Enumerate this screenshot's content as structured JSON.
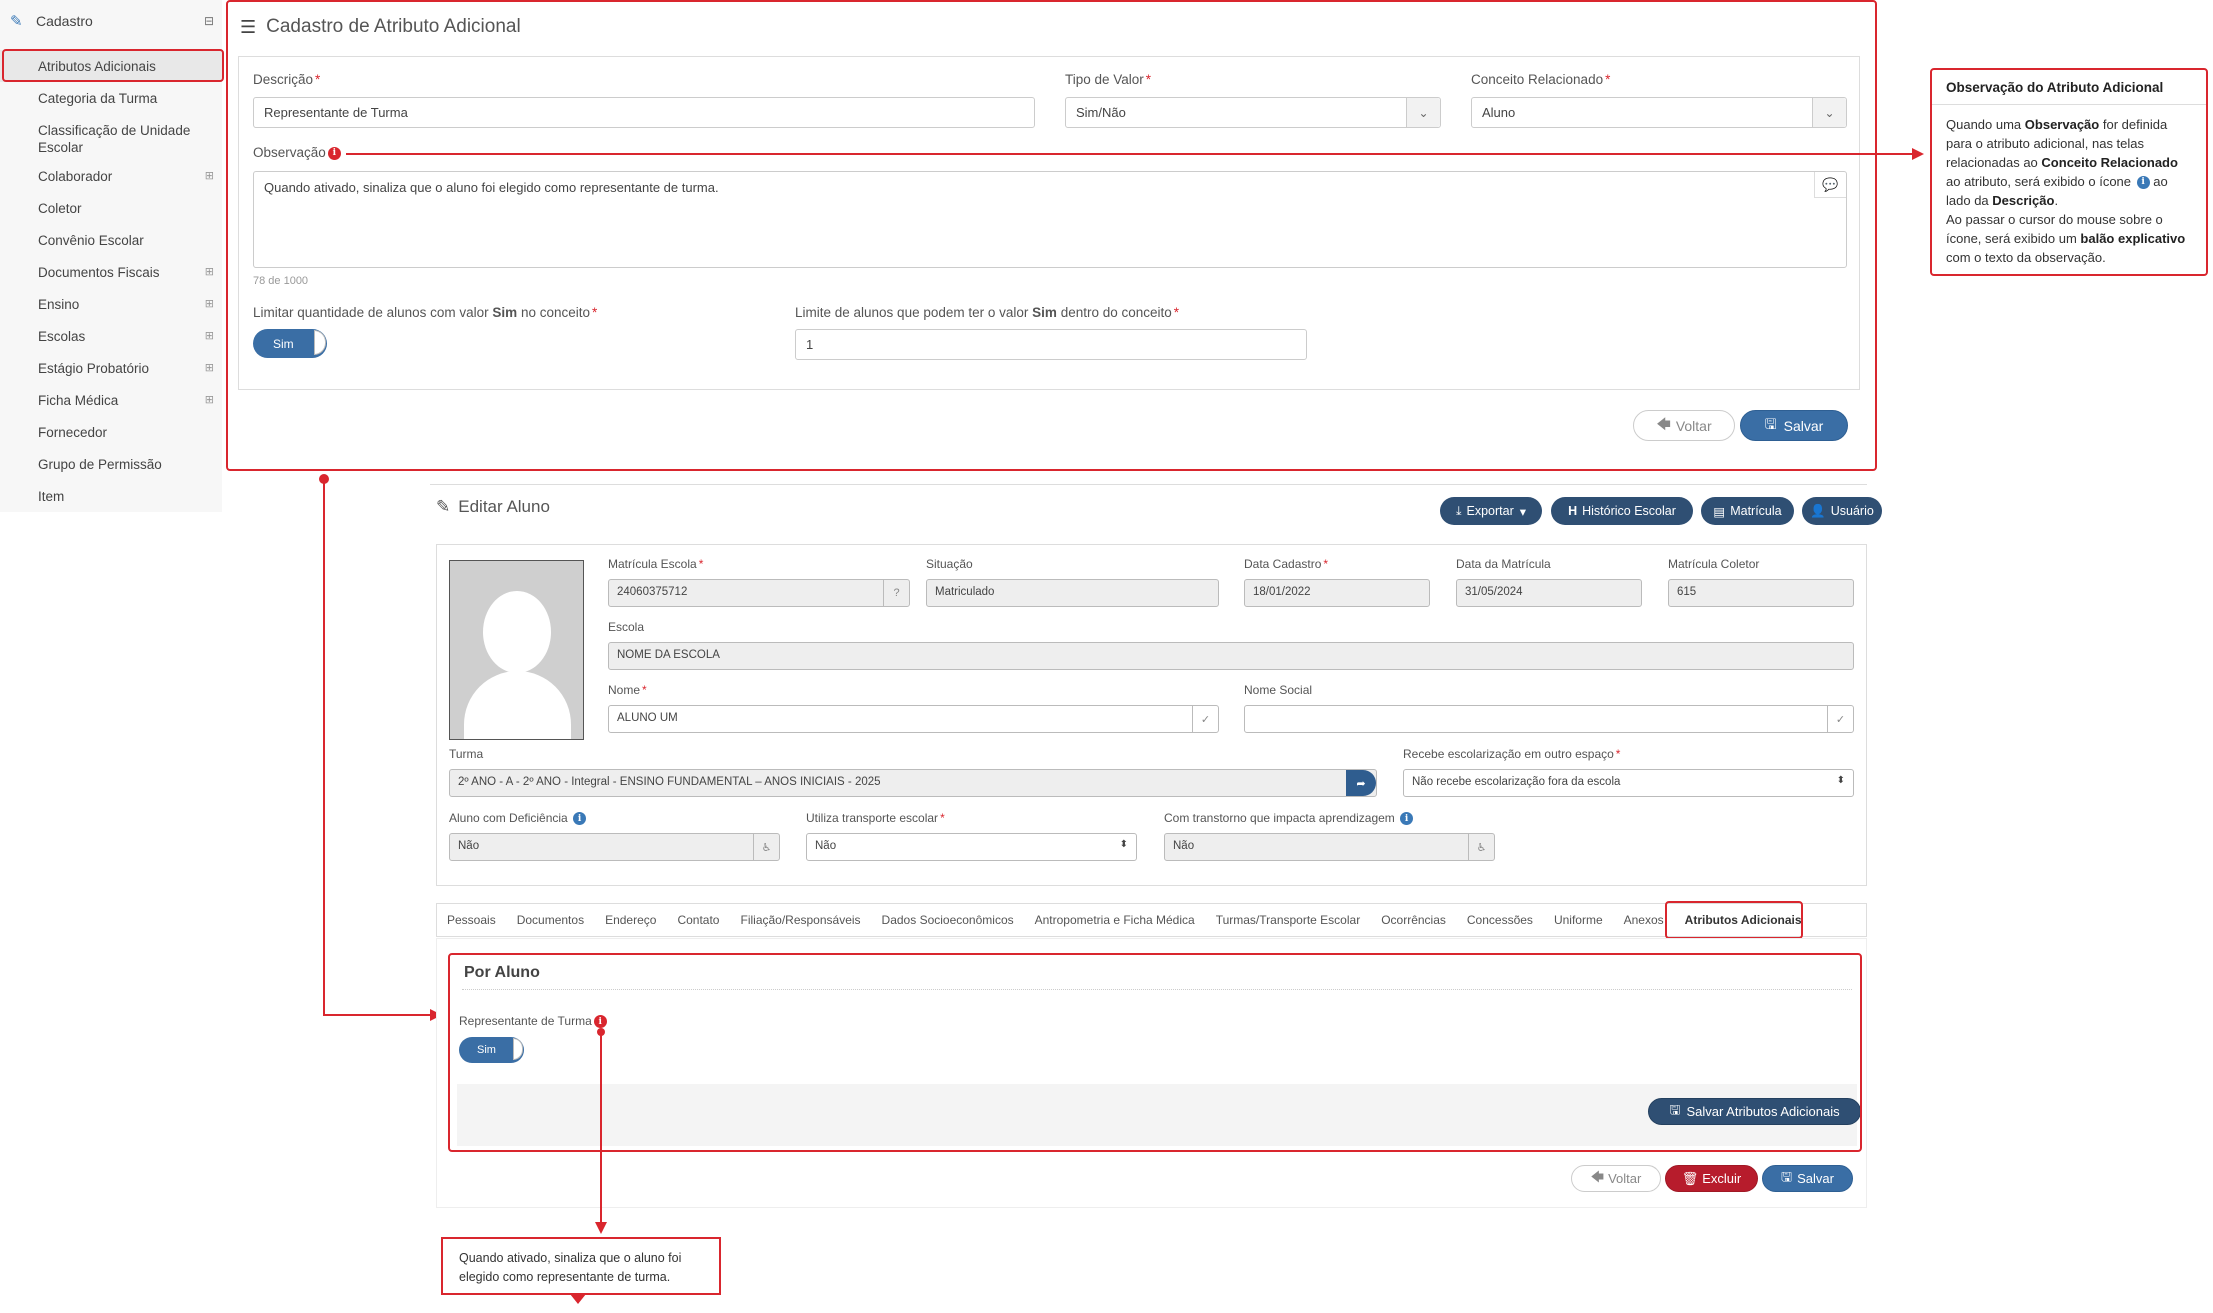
{
  "sidebar": {
    "header": "Cadastro",
    "items": [
      {
        "label": "Atributos Adicionais",
        "expandable": false
      },
      {
        "label": "Categoria da Turma",
        "expandable": false
      },
      {
        "label": "Classificação de Unidade Escolar",
        "expandable": false
      },
      {
        "label": "Colaborador",
        "expandable": true
      },
      {
        "label": "Coletor",
        "expandable": false
      },
      {
        "label": "Convênio Escolar",
        "expandable": false
      },
      {
        "label": "Documentos Fiscais",
        "expandable": true
      },
      {
        "label": "Ensino",
        "expandable": true
      },
      {
        "label": "Escolas",
        "expandable": true
      },
      {
        "label": "Estágio Probatório",
        "expandable": true
      },
      {
        "label": "Ficha Médica",
        "expandable": true
      },
      {
        "label": "Fornecedor",
        "expandable": false
      },
      {
        "label": "Grupo de Permissão",
        "expandable": false
      },
      {
        "label": "Item",
        "expandable": false
      }
    ]
  },
  "form": {
    "title": "Cadastro de Atributo Adicional",
    "descricao_label": "Descrição",
    "descricao_value": "Representante de Turma",
    "tipo_label": "Tipo de Valor",
    "tipo_value": "Sim/Não",
    "conceito_label": "Conceito Relacionado",
    "conceito_value": "Aluno",
    "observacao_label": "Observação",
    "observacao_value": "Quando ativado, sinaliza que o aluno foi elegido como representante de turma.",
    "char_count": "78 de 1000",
    "limitar_label_pre": "Limitar quantidade de alunos com valor",
    "limitar_label_bold": "Sim",
    "limitar_label_post": "no conceito",
    "limitar_toggle": "Sim",
    "limite_label_pre": "Limite de alunos que podem ter o valor",
    "limite_label_bold": "Sim",
    "limite_label_post": "dentro do conceito",
    "limite_value": "1",
    "btn_voltar": "Voltar",
    "btn_salvar": "Salvar"
  },
  "note": {
    "title": "Observação do Atributo Adicional",
    "p1": "Quando uma",
    "p1b": "Observação",
    "p2": "for definida para o atributo adicional, nas telas relacionadas ao",
    "p2b": "Conceito Relacionado",
    "p3": "ao atributo, será exibido o ícone",
    "p4": "ao lado da",
    "p4b": "Descrição",
    "p4c": ".",
    "p5": "Ao passar o cursor do mouse sobre o ícone, será exibido um",
    "p5b": "balão explicativo",
    "p6": "com o texto da observação."
  },
  "aluno": {
    "title": "Editar Aluno",
    "btn_exportar": "Exportar",
    "btn_historico": "Histórico Escolar",
    "btn_matricula": "Matrícula",
    "btn_usuario": "Usuário",
    "matricula_escola_label": "Matrícula Escola",
    "matricula_escola_value": "24060375712",
    "situacao_label": "Situação",
    "situacao_value": "Matriculado",
    "data_cadastro_label": "Data Cadastro",
    "data_cadastro_value": "18/01/2022",
    "data_matricula_label": "Data da Matrícula",
    "data_matricula_value": "31/05/2024",
    "matricula_coletor_label": "Matrícula Coletor",
    "matricula_coletor_value": "615",
    "escola_label": "Escola",
    "escola_value": "NOME DA ESCOLA",
    "nome_label": "Nome",
    "nome_value": "ALUNO UM",
    "nome_social_label": "Nome Social",
    "nome_social_value": "",
    "turma_label": "Turma",
    "turma_value": "2º ANO - A - 2º ANO - Integral - ENSINO FUNDAMENTAL – ANOS INICIAIS - 2025",
    "recebe_label": "Recebe escolarização em outro espaço",
    "recebe_value": "Não recebe escolarização fora da escola",
    "deficiencia_label": "Aluno com Deficiência",
    "deficiencia_value": "Não",
    "transporte_label": "Utiliza transporte escolar",
    "transporte_value": "Não",
    "transtorno_label": "Com transtorno que impacta aprendizagem",
    "transtorno_value": "Não",
    "tabs": [
      "Pessoais",
      "Documentos",
      "Endereço",
      "Contato",
      "Filiação/Responsáveis",
      "Dados Socioeconômicos",
      "Antropometria e Ficha Médica",
      "Turmas/Transporte Escolar",
      "Ocorrências",
      "Concessões",
      "Uniforme",
      "Anexos",
      "Atributos Adicionais"
    ],
    "section_title": "Por Aluno",
    "attr_label": "Representante de Turma",
    "attr_toggle": "Sim",
    "btn_salvar_attr": "Salvar Atributos Adicionais",
    "btn_voltar": "Voltar",
    "btn_excluir": "Excluir",
    "btn_salvar": "Salvar"
  },
  "hint": {
    "text": "Quando ativado, sinaliza que o aluno foi elegido como representante de turma."
  },
  "colors": {
    "annotation_red": "#d9262e",
    "primary_blue": "#3a6ea5",
    "dark_blue": "#2f4f73",
    "danger": "#b71c2c"
  }
}
